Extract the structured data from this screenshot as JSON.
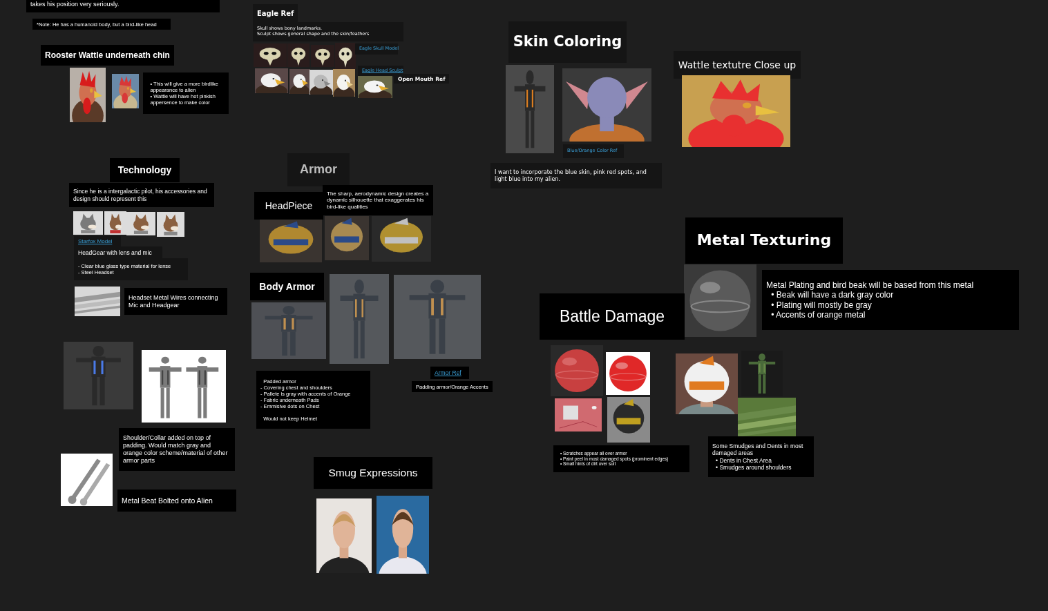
{
  "board": {
    "items": [
      {
        "kind": "note",
        "text": "takes his position very seriously."
      },
      {
        "kind": "note",
        "text": "*Note: He has a humanoid body, but a bird-like head"
      },
      {
        "kind": "heading",
        "text": "Rooster Wattle underneath chin"
      },
      {
        "kind": "picture"
      },
      {
        "kind": "picture"
      },
      {
        "kind": "list",
        "bullets": [
          "• This will give a more birdlike appearance to alien",
          "• Wattle will have hot pinkish appersence to make color"
        ]
      },
      {
        "kind": "heading",
        "text": "Eagle Ref"
      },
      {
        "kind": "note",
        "text": "Skull shows bony landmarks.\nSculpt shows general shape and the skin/feathers"
      },
      {
        "kind": "picture"
      },
      {
        "kind": "picture"
      },
      {
        "kind": "picture"
      },
      {
        "kind": "picture"
      },
      {
        "kind": "link",
        "text": "Eagle Skull Model"
      },
      {
        "kind": "picture"
      },
      {
        "kind": "picture"
      },
      {
        "kind": "picture"
      },
      {
        "kind": "picture"
      },
      {
        "kind": "link",
        "text": "Eagle Head Sculpt"
      },
      {
        "kind": "picture"
      },
      {
        "kind": "heading",
        "text": "Open Mouth Ref"
      },
      {
        "kind": "heading",
        "text": "Skin Coloring"
      },
      {
        "kind": "picture"
      },
      {
        "kind": "picture"
      },
      {
        "kind": "link",
        "text": "Blue/Orange Color Ref"
      },
      {
        "kind": "note",
        "text": "I want to incorporate the blue skin, pink red spots, and light blue into my alien."
      },
      {
        "kind": "heading",
        "text": "Wattle textutre Close up"
      },
      {
        "kind": "picture"
      },
      {
        "kind": "heading",
        "text": "Technology"
      },
      {
        "kind": "note",
        "text": "Since he is a intergalactic pilot, his accessories and design should represent this"
      },
      {
        "kind": "picture"
      },
      {
        "kind": "picture"
      },
      {
        "kind": "picture"
      },
      {
        "kind": "picture"
      },
      {
        "kind": "link",
        "text": "Starfox Model"
      },
      {
        "kind": "note",
        "text": "HeadGear with lens and mic"
      },
      {
        "kind": "note",
        "text": "- Clear blue glass type material for lense\n- Steel Headset"
      },
      {
        "kind": "picture"
      },
      {
        "kind": "note",
        "text": "Headset Metal Wires connecting Mic and Headgear"
      },
      {
        "kind": "picture"
      },
      {
        "kind": "picture"
      },
      {
        "kind": "note",
        "text": "Shoulder/Collar added on top of padding. Would match gray and orange color scheme/material of other armor parts"
      },
      {
        "kind": "picture"
      },
      {
        "kind": "note",
        "text": "Metal Beat Bolted onto Alien"
      },
      {
        "kind": "heading",
        "text": "Armor"
      },
      {
        "kind": "heading",
        "text": "HeadPiece"
      },
      {
        "kind": "note",
        "text": "The sharp, aerodynamic design creates a dynamic silhouette that exaggerates his bird-like qualities"
      },
      {
        "kind": "picture"
      },
      {
        "kind": "picture"
      },
      {
        "kind": "picture"
      },
      {
        "kind": "heading",
        "text": "Body Armor"
      },
      {
        "kind": "picture"
      },
      {
        "kind": "picture"
      },
      {
        "kind": "picture"
      },
      {
        "kind": "note",
        "text": "  Padded armor\n- Covering chest and shoulders\n- Pallete is gray with accents of Orange\n- Fabric underneath Pads\n- Emmisive dots on Chest\n\n  Would not keep Helmet"
      },
      {
        "kind": "link",
        "text": "Armor Ref"
      },
      {
        "kind": "note",
        "text": "Padding armor/Orange Accents"
      },
      {
        "kind": "heading",
        "text": "Smug Expressions"
      },
      {
        "kind": "picture"
      },
      {
        "kind": "picture"
      },
      {
        "kind": "heading",
        "text": "Metal Texturing"
      },
      {
        "kind": "picture"
      },
      {
        "kind": "list",
        "intro": "Metal Plating and bird beak will be based from this metal",
        "bullets": [
          "• Beak will have a dark gray color",
          "• Plating will mostly be gray",
          "• Accents of orange metal"
        ]
      },
      {
        "kind": "heading",
        "text": "Battle Damage"
      },
      {
        "kind": "picture"
      },
      {
        "kind": "picture"
      },
      {
        "kind": "picture"
      },
      {
        "kind": "picture"
      },
      {
        "kind": "list",
        "bullets": [
          "• Scratches appear all over armor",
          "• Paint peel in most damaged spots (prominent edges)",
          "• Small hints of dirt over suit"
        ]
      },
      {
        "kind": "picture"
      },
      {
        "kind": "picture"
      },
      {
        "kind": "picture"
      },
      {
        "kind": "list",
        "intro": "Some Smudges and Dents in most damaged areas",
        "bullets": [
          "• Dents in Chest Area",
          "• Smudges around shoulders"
        ]
      }
    ]
  }
}
